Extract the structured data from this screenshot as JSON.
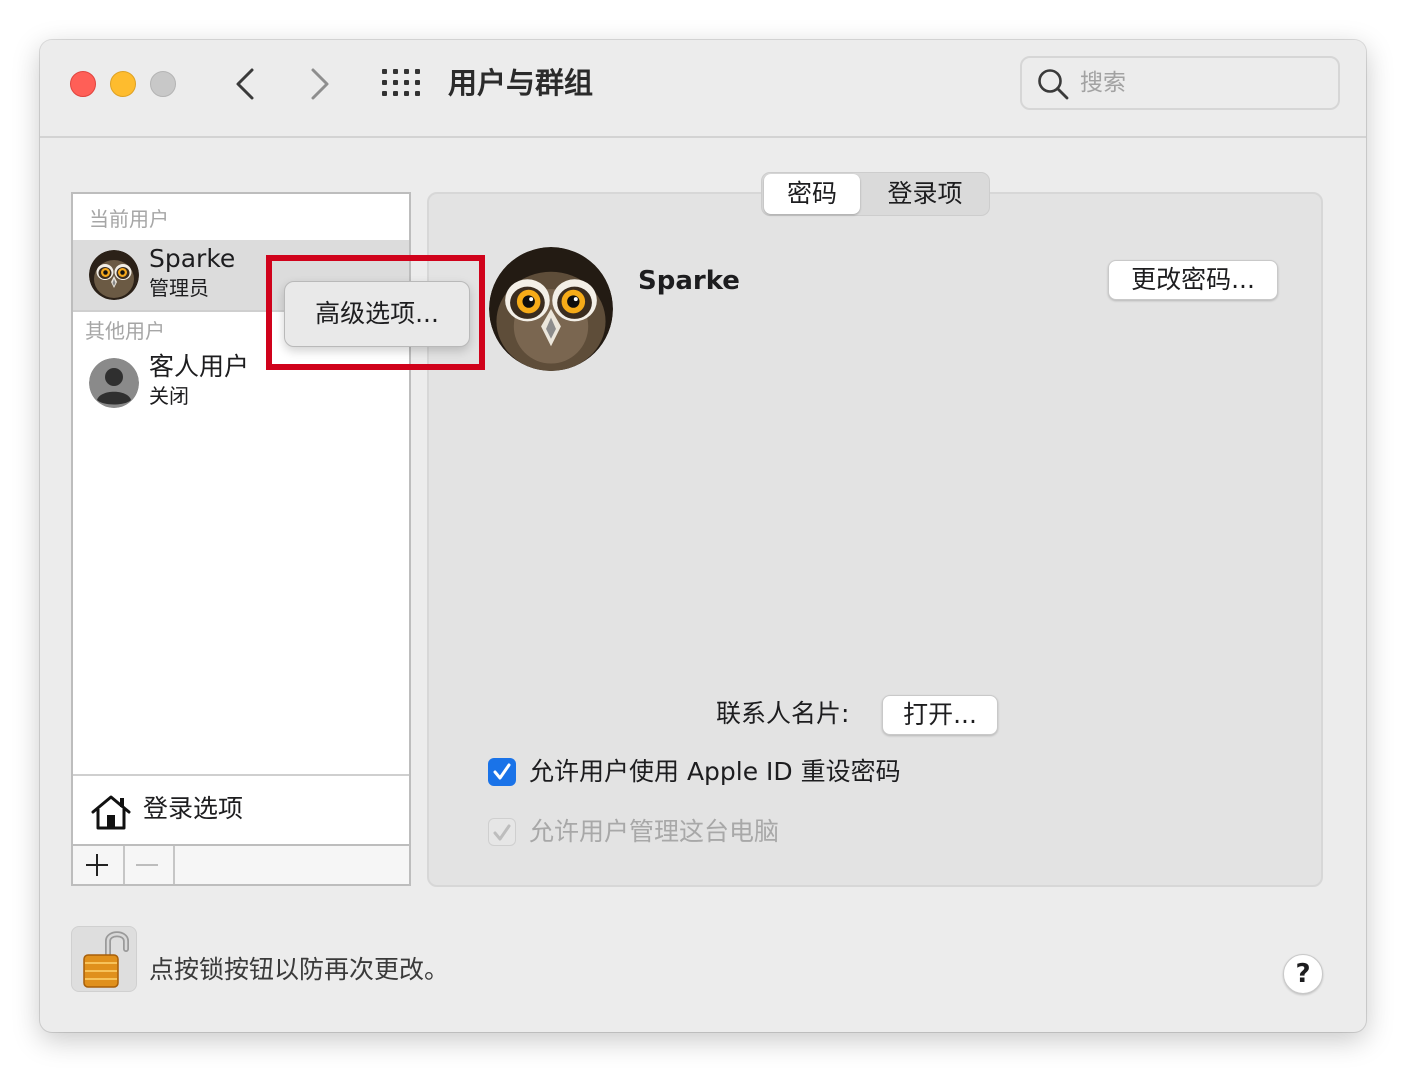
{
  "window": {
    "title": "用户与群组",
    "search_placeholder": "搜索"
  },
  "sidebar": {
    "current_users_header": "当前用户",
    "other_users_header": "其他用户",
    "users": [
      {
        "name": "Sparke",
        "role": "管理员",
        "selected": true
      },
      {
        "name": "客人用户",
        "role": "关闭",
        "selected": false
      }
    ],
    "login_options_label": "登录选项"
  },
  "context_menu": {
    "items": [
      "高级选项..."
    ]
  },
  "tabs": [
    {
      "label": "密码",
      "active": true
    },
    {
      "label": "登录项",
      "active": false
    }
  ],
  "profile": {
    "name": "Sparke",
    "change_password_label": "更改密码...",
    "contact_card_label": "联系人名片:",
    "open_label": "打开..."
  },
  "options": [
    {
      "label": "允许用户使用 Apple ID 重设密码",
      "checked": true,
      "enabled": true
    },
    {
      "label": "允许用户管理这台电脑",
      "checked": true,
      "enabled": false
    }
  ],
  "footer": {
    "lock_text": "点按锁按钮以防再次更改。",
    "help_label": "?"
  },
  "colors": {
    "accent": "#1a73e8",
    "highlight": "#d0021b",
    "window_bg": "#ececec"
  },
  "icons": [
    "back-chevron-icon",
    "forward-chevron-icon",
    "grid-icon",
    "search-icon",
    "owl-avatar",
    "guest-avatar-icon",
    "house-icon",
    "plus-icon",
    "minus-icon",
    "padlock-open-icon",
    "checkmark-icon"
  ]
}
